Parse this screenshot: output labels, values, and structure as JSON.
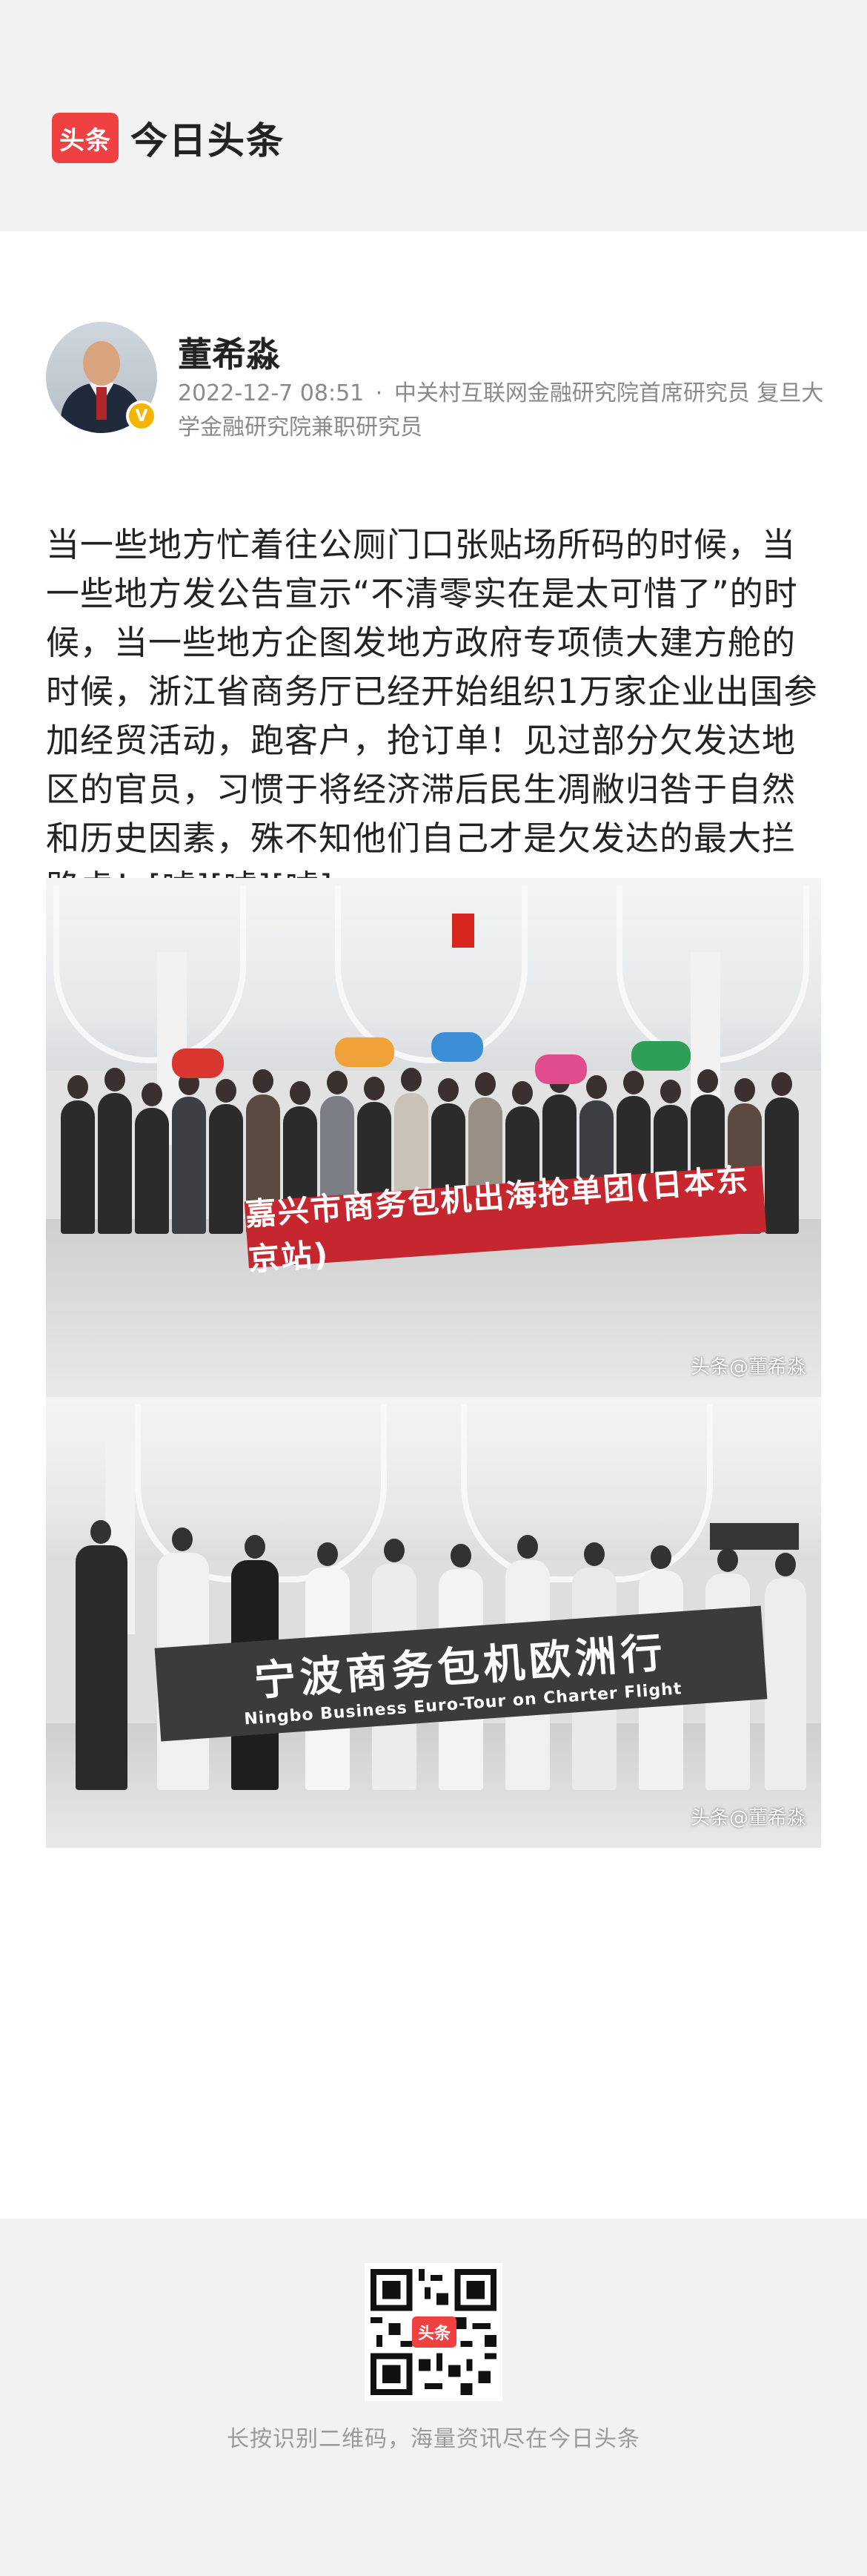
{
  "brand": {
    "logo_text": "头条",
    "name": "今日头条",
    "logo_color": "#f04142"
  },
  "author": {
    "name": "董希淼",
    "verified_icon": "v-badge-icon",
    "timestamp": "2022-12-7 08:51",
    "separator": "·",
    "title": "中关村互联网金融研究院首席研究员 复旦大学金融研究院兼职研究员"
  },
  "article": {
    "text": "当一些地方忙着往公厕门口张贴场所码的时候，当一些地方发公告宣示“不清零实在是太可惜了”的时候，当一些地方企图发地方政府专项债大建方舱的时候，浙江省商务厅已经开始组织1万家企业出国参加经贸活动，跑客户，抢订单！见过部分欠发达地区的官员，习惯于将经济滞后民生凋敝归咎于自然和历史因素，殊不知他们自己才是欠发达的最大拦路虎！[嘘][嘘][嘘]"
  },
  "photos": [
    {
      "banner_text": "嘉兴市商务包机出海抢单团(日本东京站)",
      "watermark": "头条@董希淼"
    },
    {
      "banner_text": "宁波商务包机欧洲行",
      "banner_subtext": "Ningbo Business Euro-Tour on Charter Flight",
      "watermark": "头条@董希淼"
    }
  ],
  "footer": {
    "qr_badge": "头条",
    "caption": "长按识别二维码，海量资讯尽在今日头条"
  }
}
